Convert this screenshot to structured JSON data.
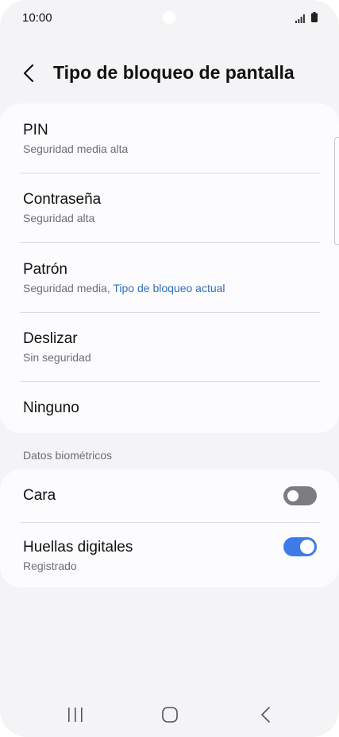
{
  "status_bar": {
    "time": "10:00"
  },
  "header": {
    "title": "Tipo de bloqueo de pantalla"
  },
  "lock_options": [
    {
      "label": "PIN",
      "subtitle": "Seguridad media alta"
    },
    {
      "label": "Contraseña",
      "subtitle": "Seguridad alta"
    },
    {
      "label": "Patrón",
      "subtitle": "Seguridad media, ",
      "subtitle_accent": "Tipo de bloqueo actual"
    },
    {
      "label": "Deslizar",
      "subtitle": "Sin seguridad"
    },
    {
      "label": "Ninguno"
    }
  ],
  "biometrics": {
    "section_label": "Datos biométricos",
    "items": [
      {
        "label": "Cara",
        "toggle": "off"
      },
      {
        "label": "Huellas digitales",
        "subtitle": "Registrado",
        "toggle": "on"
      }
    ]
  },
  "colors": {
    "accent": "#3e7be8",
    "link": "#2f6fb7",
    "background": "#f4f4f6",
    "card": "#fcfcfe"
  },
  "navigation": {
    "icons": [
      "recent-apps-icon",
      "home-icon",
      "back-icon"
    ]
  }
}
